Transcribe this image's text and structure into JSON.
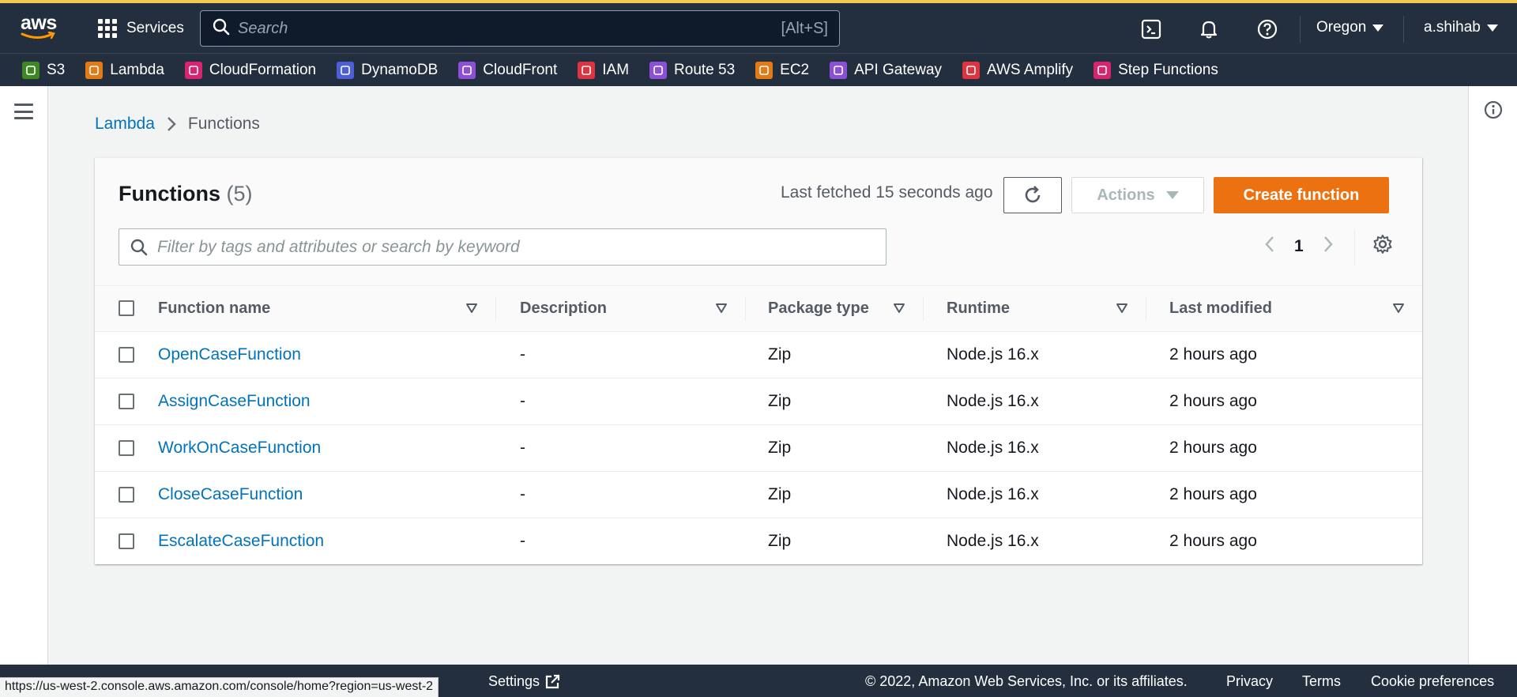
{
  "topnav": {
    "logo_text": "aws",
    "services_label": "Services",
    "search_placeholder": "Search",
    "search_shortcut": "[Alt+S]",
    "region": "Oregon",
    "user": "a.shihab"
  },
  "favorites": [
    {
      "label": "S3",
      "icon": "s3-icon",
      "color": "#3f8624"
    },
    {
      "label": "Lambda",
      "icon": "lambda-icon",
      "color": "#e07b16"
    },
    {
      "label": "CloudFormation",
      "icon": "cloudformation-icon",
      "color": "#d6246e"
    },
    {
      "label": "DynamoDB",
      "icon": "dynamodb-icon",
      "color": "#4d5fd6"
    },
    {
      "label": "CloudFront",
      "icon": "cloudfront-icon",
      "color": "#8b4fd8"
    },
    {
      "label": "IAM",
      "icon": "iam-icon",
      "color": "#dd3440"
    },
    {
      "label": "Route 53",
      "icon": "route53-icon",
      "color": "#8b4fd8"
    },
    {
      "label": "EC2",
      "icon": "ec2-icon",
      "color": "#e07b16"
    },
    {
      "label": "API Gateway",
      "icon": "apigateway-icon",
      "color": "#8b4fd8"
    },
    {
      "label": "AWS Amplify",
      "icon": "amplify-icon",
      "color": "#dd3440"
    },
    {
      "label": "Step Functions",
      "icon": "stepfunctions-icon",
      "color": "#d6246e"
    }
  ],
  "breadcrumb": {
    "parent": "Lambda",
    "current": "Functions"
  },
  "panel": {
    "title": "Functions",
    "count": "(5)",
    "last_fetched": "Last fetched 15 seconds ago",
    "actions_label": "Actions",
    "create_label": "Create function",
    "filter_placeholder": "Filter by tags and attributes or search by keyword",
    "page": "1"
  },
  "table": {
    "columns": [
      "Function name",
      "Description",
      "Package type",
      "Runtime",
      "Last modified"
    ],
    "rows": [
      {
        "name": "OpenCaseFunction",
        "description": "-",
        "package": "Zip",
        "runtime": "Node.js 16.x",
        "modified": "2 hours ago"
      },
      {
        "name": "AssignCaseFunction",
        "description": "-",
        "package": "Zip",
        "runtime": "Node.js 16.x",
        "modified": "2 hours ago"
      },
      {
        "name": "WorkOnCaseFunction",
        "description": "-",
        "package": "Zip",
        "runtime": "Node.js 16.x",
        "modified": "2 hours ago"
      },
      {
        "name": "CloseCaseFunction",
        "description": "-",
        "package": "Zip",
        "runtime": "Node.js 16.x",
        "modified": "2 hours ago"
      },
      {
        "name": "EscalateCaseFunction",
        "description": "-",
        "package": "Zip",
        "runtime": "Node.js 16.x",
        "modified": "2 hours ago"
      }
    ]
  },
  "footer": {
    "settings_label": "Settings",
    "copyright": "© 2022, Amazon Web Services, Inc. or its affiliates.",
    "privacy": "Privacy",
    "terms": "Terms",
    "cookies": "Cookie preferences"
  },
  "status_url": "https://us-west-2.console.aws.amazon.com/console/home?region=us-west-2"
}
